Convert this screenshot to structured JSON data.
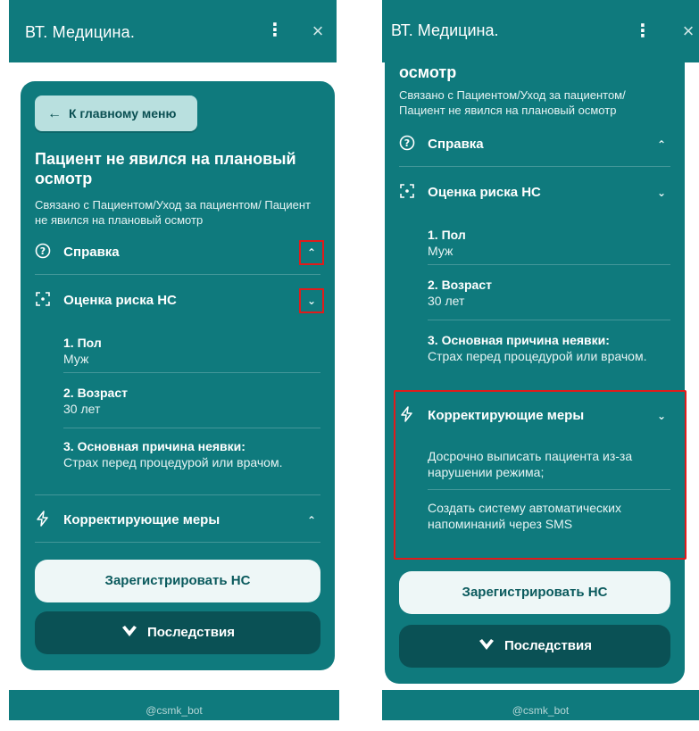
{
  "app": {
    "title": "ВТ. Медицина.",
    "close_glyph": "×",
    "kebab_glyph": "⋮",
    "footer": "@csmk_bot"
  },
  "colors": {
    "primary": "#0f7a7d",
    "dark_button": "#0a5155",
    "light_button": "#eef7f7",
    "highlight": "#e01b1b"
  },
  "screen_left": {
    "back_button": "К главному меню",
    "case_title": "Пациент не явился на плановый осмотр",
    "case_subtitle": "Связано с Пациентом/Уход за пациентом/ Пациент не явился на плановый осмотр",
    "sections": {
      "help": "Справка",
      "risk": "Оценка риска НС",
      "measures": "Корректирующие меры"
    },
    "facts": [
      {
        "k": "1. Пол",
        "v": "Муж"
      },
      {
        "k": "2. Возраст",
        "v": "30 лет"
      },
      {
        "k": "3. Основная причина неявки:",
        "v": "Страх перед процедурой или врачом."
      }
    ],
    "register_button": "Зарегистрировать НС",
    "consequences_button": "Последствия"
  },
  "screen_right": {
    "case_title_tail": "осмотр",
    "case_subtitle": "Связано с Пациентом/Уход за пациентом/ Пациент не явился на плановый осмотр",
    "sections": {
      "help": "Справка",
      "risk": "Оценка риска НС",
      "measures": "Корректирующие меры"
    },
    "facts": [
      {
        "k": "1. Пол",
        "v": "Муж"
      },
      {
        "k": "2. Возраст",
        "v": "30 лет"
      },
      {
        "k": "3. Основная причина неявки:",
        "v": "Страх перед процедурой или врачом."
      }
    ],
    "measures": [
      "Досрочно выписать пациента из-за нарушении режима;",
      "Создать систему автоматических напоминаний через SMS"
    ],
    "register_button": "Зарегистрировать НС",
    "consequences_button": "Последствия"
  },
  "icons": {
    "back": "arrow-left-icon",
    "help": "question-circle-icon",
    "risk": "scan-focus-icon",
    "measures": "lightning-icon",
    "consequences": "check-shield-icon",
    "chevron_up": "chevron-up-icon",
    "chevron_down": "chevron-down-icon"
  }
}
